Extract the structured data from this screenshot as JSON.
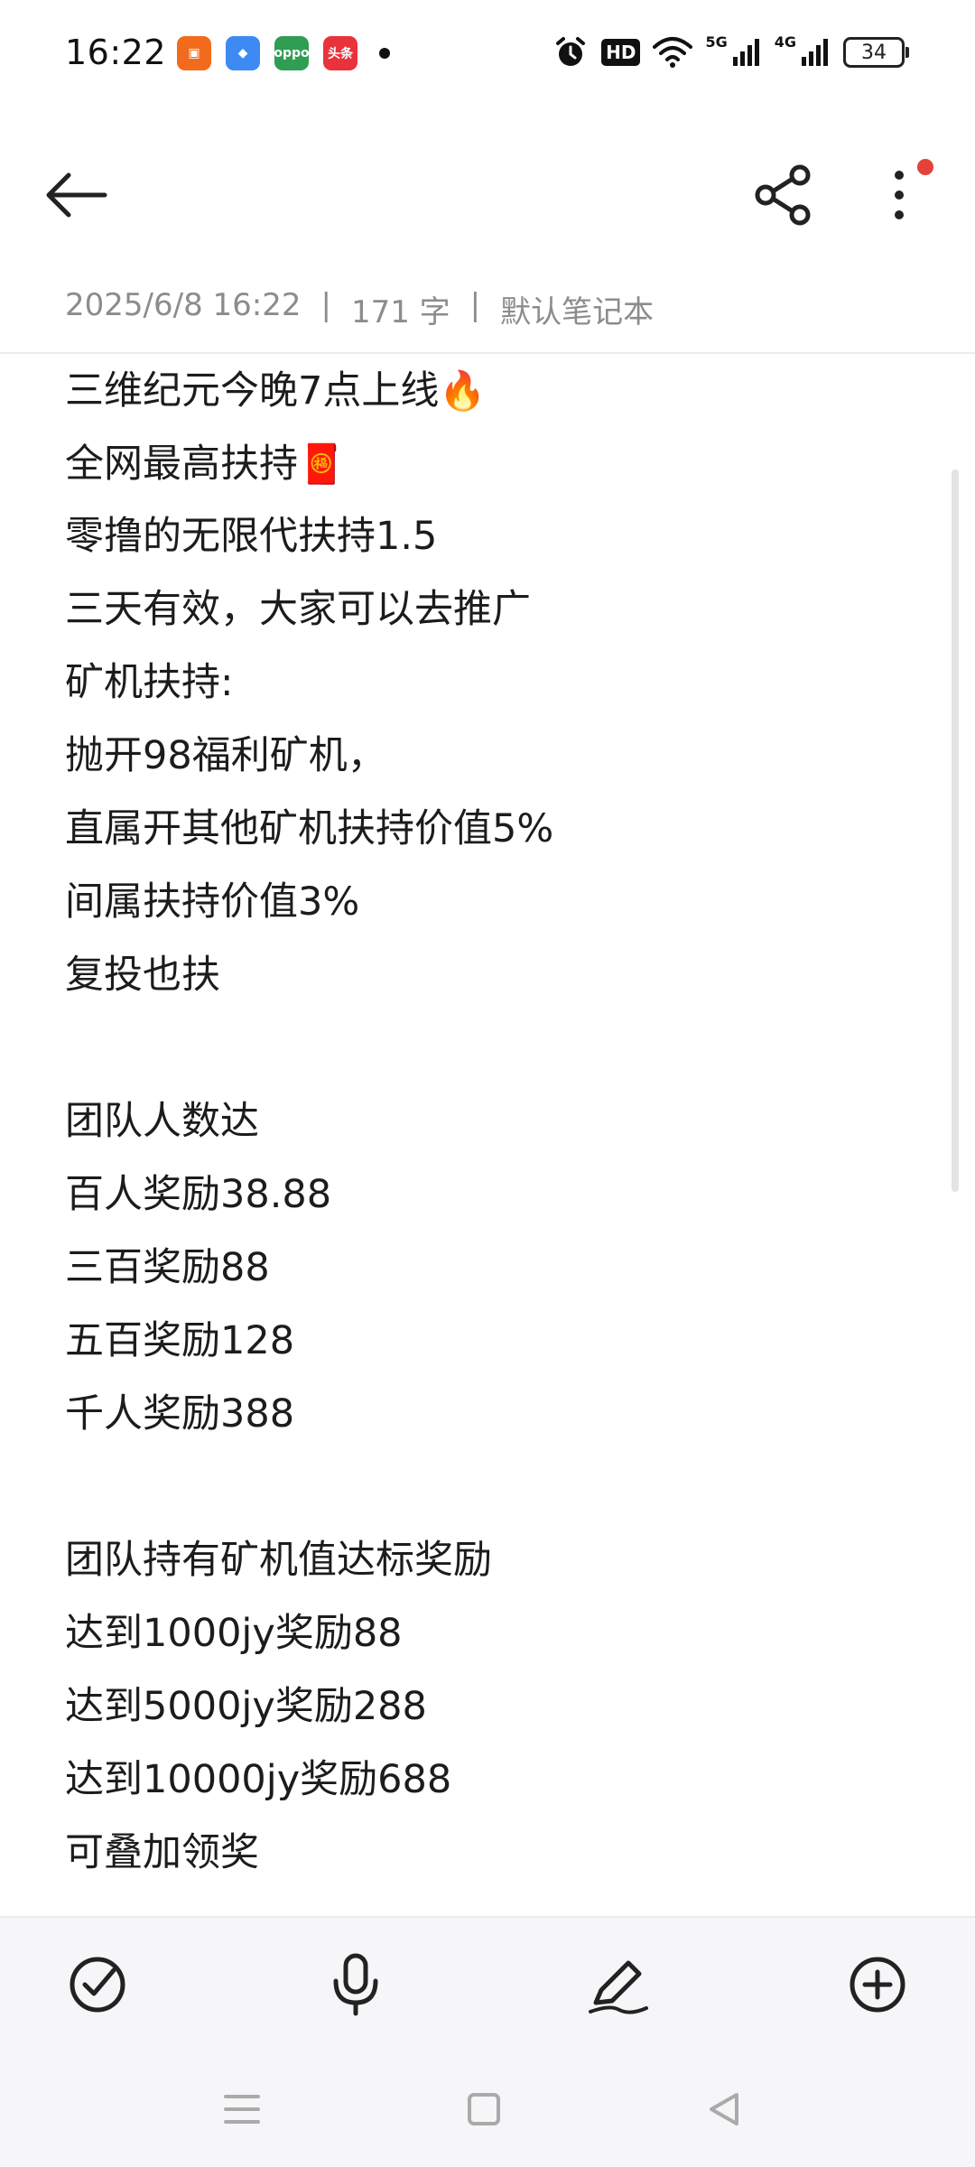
{
  "status_bar": {
    "time": "16:22",
    "notification_apps": [
      {
        "name": "orange-app-icon",
        "color": "#f26b1d",
        "glyph": "▣"
      },
      {
        "name": "blue-app-icon",
        "color": "#3d8bf2",
        "glyph": "◆"
      },
      {
        "name": "oppo-app-icon",
        "color": "#2f9e52",
        "glyph": "oppo"
      },
      {
        "name": "toutiao-app-icon",
        "color": "#e8323c",
        "glyph": "头条"
      }
    ],
    "hd_label": "HD",
    "net1": "5G",
    "net2": "4G",
    "battery": "34"
  },
  "meta": {
    "datetime": "2025/6/8 16:22",
    "separator": "|",
    "word_count": "171 字",
    "notebook": "默认笔记本"
  },
  "note": {
    "lines": [
      {
        "text": "三维纪元今晚7点上线",
        "emoji": "🔥"
      },
      {
        "text": "全网最高扶持",
        "emoji": "🧧"
      },
      {
        "text": "零撸的无限代扶持1.5",
        "emoji": ""
      },
      {
        "text": "三天有效，大家可以去推广",
        "emoji": ""
      },
      {
        "text": "矿机扶持:",
        "emoji": ""
      },
      {
        "text": "抛开98福利矿机，",
        "emoji": ""
      },
      {
        "text": "直属开其他矿机扶持价值5%",
        "emoji": ""
      },
      {
        "text": "间属扶持价值3%",
        "emoji": ""
      },
      {
        "text": "复投也扶",
        "emoji": ""
      },
      {
        "text": "",
        "emoji": ""
      },
      {
        "text": "团队人数达",
        "emoji": ""
      },
      {
        "text": "百人奖励38.88",
        "emoji": ""
      },
      {
        "text": "三百奖励88",
        "emoji": ""
      },
      {
        "text": "五百奖励128",
        "emoji": ""
      },
      {
        "text": "千人奖励388",
        "emoji": ""
      },
      {
        "text": "",
        "emoji": ""
      },
      {
        "text": "团队持有矿机值达标奖励",
        "emoji": ""
      },
      {
        "text": "达到1000jy奖励88",
        "emoji": ""
      },
      {
        "text": "达到5000jy奖励288",
        "emoji": ""
      },
      {
        "text": "达到10000jy奖励688",
        "emoji": ""
      },
      {
        "text": "可叠加领奖",
        "emoji": ""
      }
    ]
  },
  "colors": {
    "accent_dot": "#e5413b",
    "meta_text": "#8c8c8c",
    "bar_bg": "#f6f6f8"
  }
}
